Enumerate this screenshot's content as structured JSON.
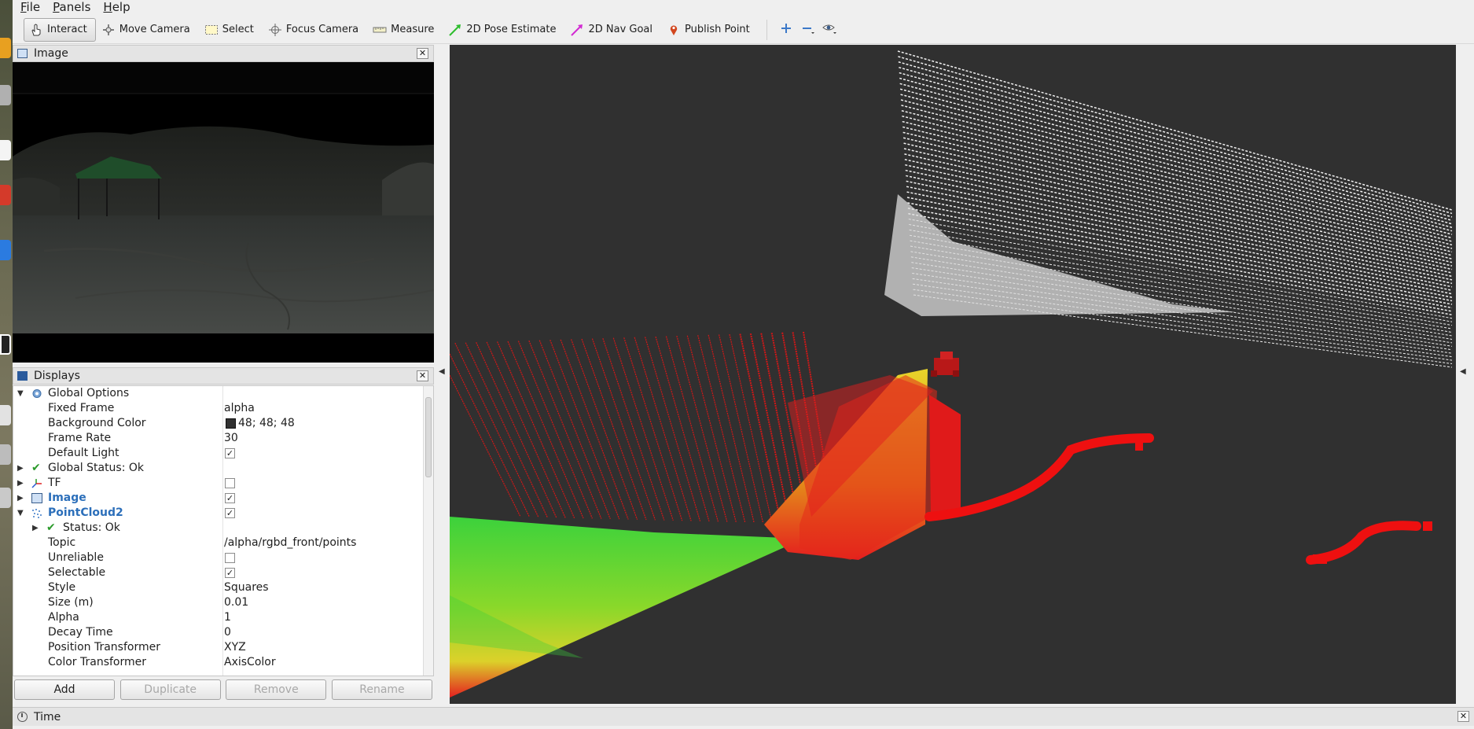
{
  "menu": [
    {
      "pre": "",
      "ul": "F",
      "post": "ile"
    },
    {
      "pre": "",
      "ul": "P",
      "post": "anels"
    },
    {
      "pre": "",
      "ul": "H",
      "post": "elp"
    }
  ],
  "toolbar": {
    "interact": "Interact",
    "move_camera": "Move Camera",
    "select": "Select",
    "focus_camera": "Focus Camera",
    "measure": "Measure",
    "pose_estimate": "2D Pose Estimate",
    "nav_goal": "2D Nav Goal",
    "publish_point": "Publish Point"
  },
  "image_panel": {
    "title": "Image",
    "close": "✕"
  },
  "displays_panel": {
    "title": "Displays",
    "close": "✕"
  },
  "tree": {
    "global_options": "Global Options",
    "fixed_frame": {
      "name": "Fixed Frame",
      "value": "alpha"
    },
    "background_color": {
      "name": "Background Color",
      "value": "48; 48; 48",
      "swatch": "#303030"
    },
    "frame_rate": {
      "name": "Frame Rate",
      "value": "30"
    },
    "default_light": {
      "name": "Default Light",
      "checked": "✓"
    },
    "global_status": "Global Status: Ok",
    "tf": {
      "name": "TF",
      "checked": ""
    },
    "image": {
      "name": "Image",
      "checked": "✓"
    },
    "pointcloud2": {
      "name": "PointCloud2",
      "checked": "✓"
    },
    "status": "Status: Ok",
    "topic": {
      "name": "Topic",
      "value": "/alpha/rgbd_front/points"
    },
    "unreliable": {
      "name": "Unreliable",
      "checked": ""
    },
    "selectable": {
      "name": "Selectable",
      "checked": "✓"
    },
    "style": {
      "name": "Style",
      "value": "Squares"
    },
    "size": {
      "name": "Size (m)",
      "value": "0.01"
    },
    "alpha": {
      "name": "Alpha",
      "value": "1"
    },
    "decay_time": {
      "name": "Decay Time",
      "value": "0"
    },
    "position_transformer": {
      "name": "Position Transformer",
      "value": "XYZ"
    },
    "color_transformer": {
      "name": "Color Transformer",
      "value": "AxisColor"
    }
  },
  "buttons": {
    "add": "Add",
    "duplicate": "Duplicate",
    "remove": "Remove",
    "rename": "Rename"
  },
  "time_panel": {
    "title": "Time",
    "close": "✕"
  },
  "colors": {
    "background": "#303030",
    "accent_blue": "#2c6fba",
    "status_green": "#2a9a2a"
  }
}
